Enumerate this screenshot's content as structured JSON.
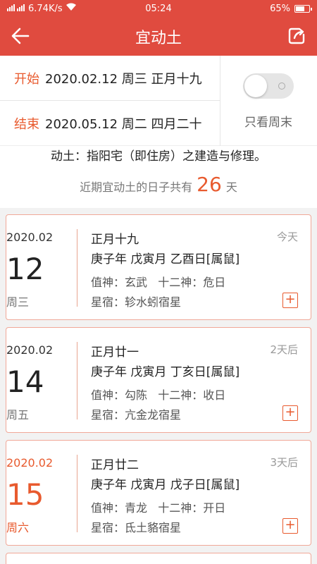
{
  "status_bar": {
    "network": "6.74K/s",
    "time": "05:24",
    "battery": "65%"
  },
  "header": {
    "title": "宜动土"
  },
  "date_range": {
    "start_label": "开始",
    "start_value": "2020.02.12 周三 正月十九",
    "end_label": "结束",
    "end_value": "2020.05.12 周二 四月二十",
    "weekend_only_label": "只看周末",
    "weekend_only_on": false
  },
  "info": {
    "description": "动土：指阳宅（即住房）之建造与修理。",
    "summary_prefix": "近期宜动土的日子共有",
    "summary_count": "26",
    "summary_suffix": "天"
  },
  "days": [
    {
      "year_month": "2020.02",
      "day": "12",
      "weekday": "周三",
      "lunar": "正月十九",
      "ganzhi": "庚子年 戊寅月 乙酉日[属鼠]",
      "zhishen": "值神：玄武",
      "shier": "十二神：危日",
      "xingxiu": "星宿：轸水蚓宿星",
      "relative": "今天",
      "weekend": false
    },
    {
      "year_month": "2020.02",
      "day": "14",
      "weekday": "周五",
      "lunar": "正月廿一",
      "ganzhi": "庚子年 戊寅月 丁亥日[属鼠]",
      "zhishen": "值神：勾陈",
      "shier": "十二神：收日",
      "xingxiu": "星宿：亢金龙宿星",
      "relative": "2天后",
      "weekend": false
    },
    {
      "year_month": "2020.02",
      "day": "15",
      "weekday": "周六",
      "lunar": "正月廿二",
      "ganzhi": "庚子年 戊寅月 戊子日[属鼠]",
      "zhishen": "值神：青龙",
      "shier": "十二神：开日",
      "xingxiu": "星宿：氐土貉宿星",
      "relative": "3天后",
      "weekend": true
    }
  ],
  "colors": {
    "brand": "#e04b3f",
    "accent": "#e85a2e"
  }
}
